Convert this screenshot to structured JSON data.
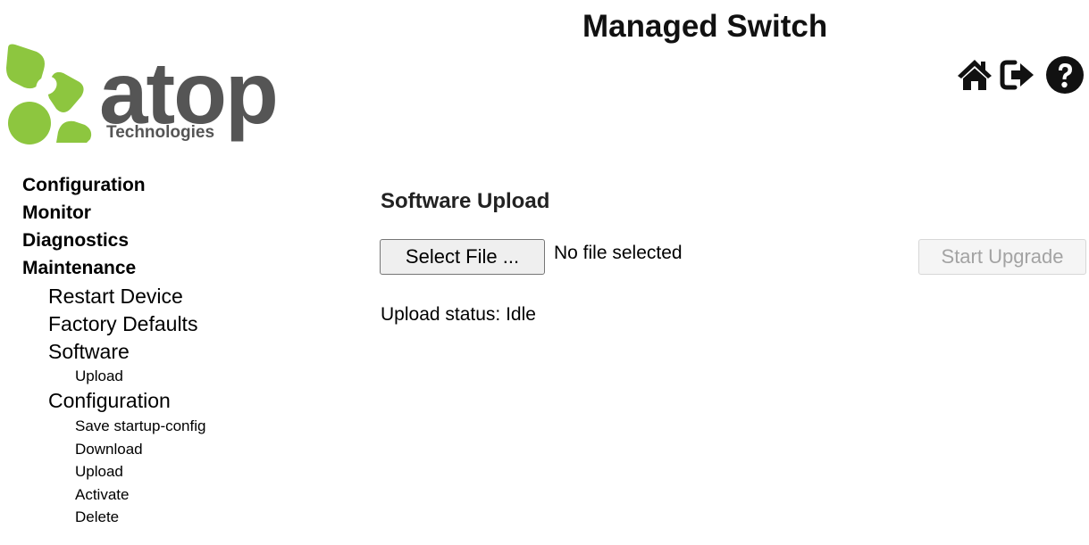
{
  "logo": {
    "brand": "atop",
    "tagline": "Technologies"
  },
  "header": {
    "title": "Managed Switch",
    "icons": [
      "home-icon",
      "logout-icon",
      "help-icon"
    ]
  },
  "nav": {
    "configuration": "Configuration",
    "monitor": "Monitor",
    "diagnostics": "Diagnostics",
    "maintenance": "Maintenance",
    "restart_device": "Restart Device",
    "factory_defaults": "Factory Defaults",
    "software": "Software",
    "software_upload": "Upload",
    "config": "Configuration",
    "save_startup_config": "Save startup-config",
    "download": "Download",
    "config_upload": "Upload",
    "activate": "Activate",
    "delete": "Delete"
  },
  "main": {
    "heading": "Software Upload",
    "select_file_label": "Select File ...",
    "file_status": "No file selected",
    "start_upgrade_label": "Start Upgrade",
    "upload_status": "Upload status: Idle"
  },
  "colors": {
    "logo_green": "#8dc63f",
    "logo_gray": "#555555",
    "disabled_text": "#a3a3a3"
  }
}
